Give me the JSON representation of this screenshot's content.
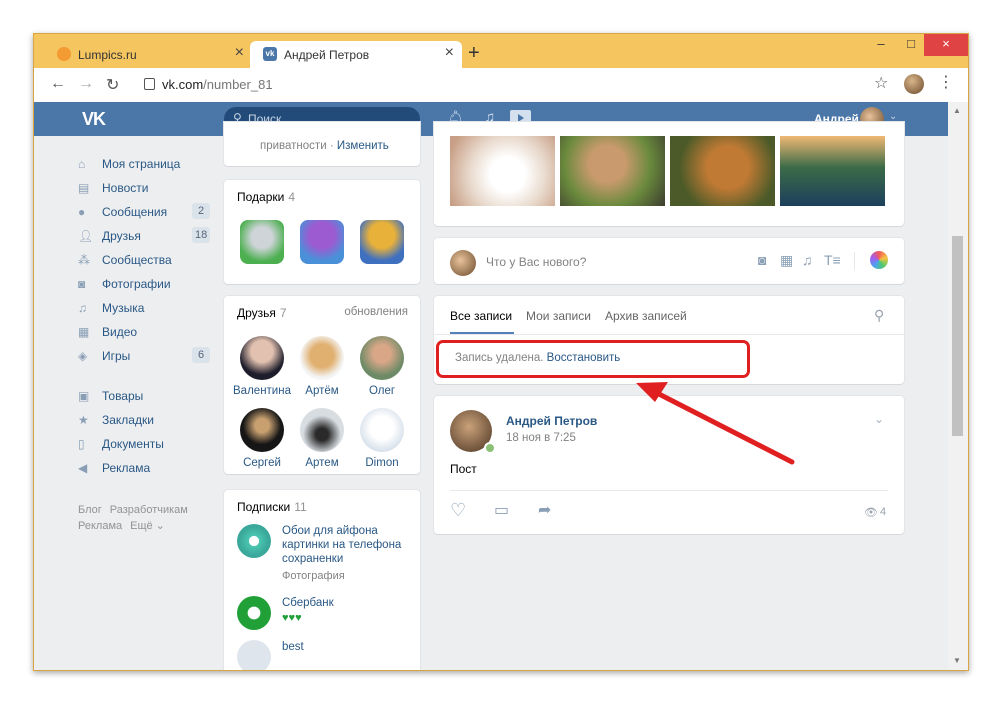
{
  "browser": {
    "tabs": [
      {
        "label": "Lumpics.ru",
        "close": "×"
      },
      {
        "label": "Андрей Петров",
        "close": "×"
      }
    ],
    "new_tab": "+",
    "url_host": "vk.com",
    "url_path": "/number_81",
    "window_controls": {
      "minimize": "–",
      "maximize": "□",
      "close": "×"
    }
  },
  "vk_header": {
    "logo": "VK",
    "search_placeholder": "Поиск",
    "user_name": "Андрей",
    "chevron": "⌄"
  },
  "sidebar": {
    "items": [
      {
        "label": "Моя страница",
        "icon": "home-icon",
        "count": ""
      },
      {
        "label": "Новости",
        "icon": "news-icon",
        "count": ""
      },
      {
        "label": "Сообщения",
        "icon": "messages-icon",
        "count": "2"
      },
      {
        "label": "Друзья",
        "icon": "friends-icon",
        "count": "18"
      },
      {
        "label": "Сообщества",
        "icon": "groups-icon",
        "count": ""
      },
      {
        "label": "Фотографии",
        "icon": "camera-icon",
        "count": ""
      },
      {
        "label": "Музыка",
        "icon": "music-icon",
        "count": ""
      },
      {
        "label": "Видео",
        "icon": "video-icon",
        "count": ""
      },
      {
        "label": "Игры",
        "icon": "games-icon",
        "count": "6"
      },
      {
        "label": "Товары",
        "icon": "bag-icon",
        "count": ""
      },
      {
        "label": "Закладки",
        "icon": "star-icon",
        "count": ""
      },
      {
        "label": "Документы",
        "icon": "document-icon",
        "count": ""
      },
      {
        "label": "Реклама",
        "icon": "megaphone-icon",
        "count": ""
      }
    ],
    "footer": [
      "Блог",
      "Разработчикам",
      "Реклама",
      "Ещё ⌄"
    ]
  },
  "privacy": {
    "text": "приватности",
    "sep": "·",
    "link": "Изменить"
  },
  "gifts": {
    "title": "Подарки",
    "count": "4"
  },
  "friends": {
    "title": "Друзья",
    "count": "7",
    "updates": "обновления",
    "people": [
      "Валентина",
      "Артём",
      "Олег",
      "Сергей",
      "Артем",
      "Dimon"
    ]
  },
  "subscriptions": {
    "title": "Подписки",
    "count": "11",
    "items": [
      {
        "title": "Обои для айфона картинки на телефона сохраненки",
        "sub": "Фотография"
      },
      {
        "title": "Сбербанк",
        "sub": "♥♥♥"
      },
      {
        "title": "best",
        "sub": ""
      }
    ]
  },
  "composer": {
    "placeholder": "Что у Вас нового?"
  },
  "wall": {
    "tabs": [
      "Все записи",
      "Мои записи",
      "Архив записей"
    ],
    "deleted_text": "Запись удалена.",
    "restore_link": "Восстановить"
  },
  "post": {
    "author": "Андрей Петров",
    "date": "18 ноя в 7:25",
    "text": "Пост",
    "views": "4"
  },
  "colors": {
    "vk_blue": "#4a76a8",
    "link": "#2a5885",
    "highlight": "#e02020"
  }
}
